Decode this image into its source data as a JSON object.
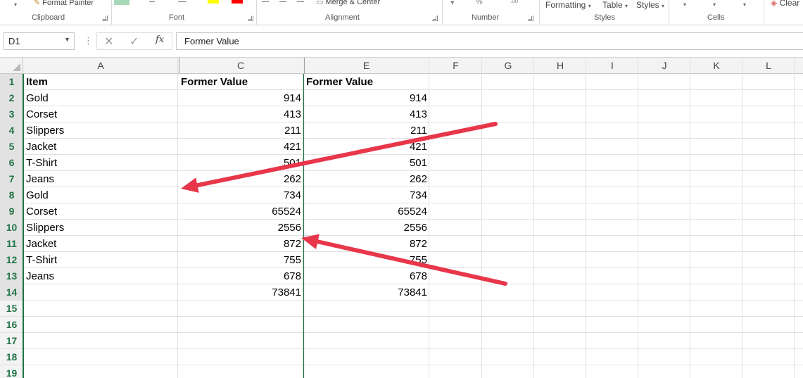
{
  "ribbon": {
    "format_painter": "Format Painter",
    "formatting": "Formatting",
    "table": "Table",
    "styles_btn": "Styles",
    "clear": "Clear",
    "merge_center": "Merge & Center",
    "groups": {
      "clipboard": "Clipboard",
      "font": "Font",
      "alignment": "Alignment",
      "number": "Number",
      "styles": "Styles",
      "cells": "Cells"
    }
  },
  "formula_bar": {
    "name_box": "D1",
    "value": "Former Value"
  },
  "columns": [
    "A",
    "C",
    "E",
    "F",
    "G",
    "H",
    "I",
    "J",
    "K",
    "L"
  ],
  "rows": [
    "1",
    "2",
    "3",
    "4",
    "5",
    "6",
    "7",
    "8",
    "9",
    "10",
    "11",
    "12",
    "13",
    "14",
    "15",
    "16",
    "17",
    "18",
    "19"
  ],
  "cells": {
    "A": [
      "Item",
      "Gold",
      "Corset",
      "Slippers",
      "Jacket",
      "T-Shirt",
      "Jeans",
      "Gold",
      "Corset",
      "Slippers",
      "Jacket",
      "T-Shirt",
      "Jeans"
    ],
    "C": [
      "Former Value",
      "914",
      "413",
      "211",
      "421",
      "501",
      "262",
      "734",
      "65524",
      "2556",
      "872",
      "755",
      "678",
      "73841"
    ],
    "E": [
      "Former Value",
      "914",
      "413",
      "211",
      "421",
      "501",
      "262",
      "734",
      "65524",
      "2556",
      "872",
      "755",
      "678",
      "73841"
    ]
  },
  "colors": {
    "accent_green": "#217346",
    "arrow_red": "#e8364a",
    "gridline": "#e1e1e1"
  }
}
